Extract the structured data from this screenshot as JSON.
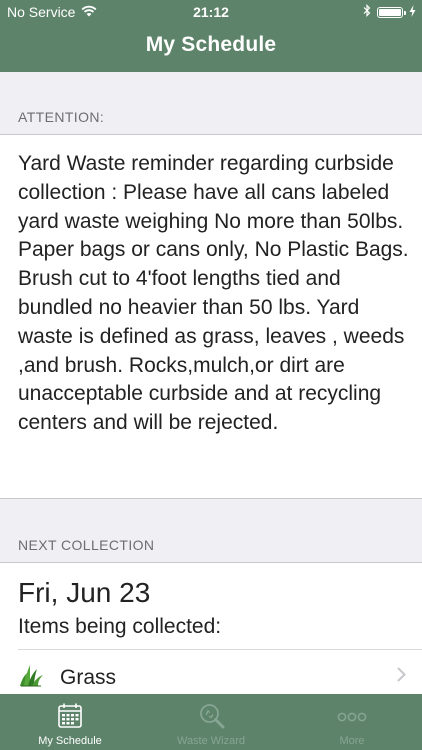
{
  "status_bar": {
    "carrier": "No Service",
    "time": "21:12",
    "icons": [
      "wifi-icon",
      "bluetooth-icon",
      "battery-icon",
      "charging-bolt-icon"
    ]
  },
  "header": {
    "title": "My Schedule"
  },
  "attention": {
    "label": "ATTENTION:",
    "message": "Yard Waste reminder regarding curbside collection : Please have all cans labeled yard waste weighing No more than 50lbs. Paper bags or cans only, No Plastic Bags. Brush cut to 4'foot lengths tied and bundled no heavier than 50 lbs. Yard waste is defined as grass, leaves , weeds ,and brush. Rocks,mulch,or dirt are unacceptable curbside and at recycling centers and will be rejected."
  },
  "next_collection": {
    "label": "NEXT COLLECTION",
    "date": "Fri, Jun 23",
    "subtitle": "Items being collected:",
    "items": [
      {
        "label": "Grass",
        "icon": "grass-icon"
      }
    ]
  },
  "tabs": [
    {
      "label": "My Schedule",
      "icon": "calendar-icon",
      "active": true
    },
    {
      "label": "Waste Wizard",
      "icon": "magnifier-recycle-icon",
      "active": false
    },
    {
      "label": "More",
      "icon": "more-dots-icon",
      "active": false
    }
  ],
  "colors": {
    "brand_green": "#5d836a",
    "inactive_tab": "#86a693",
    "background": "#efeff4"
  }
}
